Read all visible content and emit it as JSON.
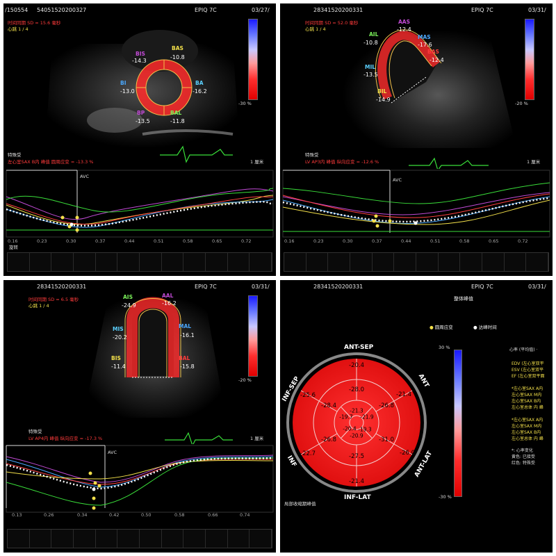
{
  "panels": [
    {
      "header": {
        "left": "/150554",
        "id": "54051520200327",
        "device": "EPIQ 7C",
        "date": "03/27/"
      },
      "info": {
        "line1": "时间同期 SD = 15.6 毫秒",
        "line2": "心跳 1 / 4"
      },
      "labels": [
        {
          "name": "BIS",
          "value": "-14.3",
          "color": "#c24bd6"
        },
        {
          "name": "BAS",
          "value": "-10.8",
          "color": "#f3e04a"
        },
        {
          "name": "BI",
          "value": "-13.0",
          "color": "#4aa8ff"
        },
        {
          "name": "BA",
          "value": "-16.2",
          "color": "#5ad0ff"
        },
        {
          "name": "BP",
          "value": "-13.5",
          "color": "#c24bd6"
        },
        {
          "name": "BAL",
          "value": "-11.8",
          "color": "#7bf05a"
        }
      ],
      "scale_label": "-30 %",
      "cm_label": "1 厘米",
      "footer_line1": "特殊受",
      "footer_line2": "左心室SAX B内 峰值 圆周应变 = -13.3 %",
      "avc": "AVC",
      "x_ticks": [
        "0.16",
        "0.23",
        "0.30",
        "0.37",
        "0.44",
        "0.51",
        "0.58",
        "0.65",
        "0.72"
      ],
      "graph_title": "旋转"
    },
    {
      "header": {
        "left": "",
        "id": "28341520200331",
        "device": "EPIQ 7C",
        "date": "03/31/"
      },
      "info": {
        "line1": "时间同期 SD = 52.0 毫秒",
        "line2": "心跳 1 / 4"
      },
      "labels": [
        {
          "name": "AAS",
          "value": "-12.4",
          "color": "#c24bd6"
        },
        {
          "name": "AIL",
          "value": "-10.8",
          "color": "#7bf05a"
        },
        {
          "name": "MAS",
          "value": "-17.6",
          "color": "#4aa8ff"
        },
        {
          "name": "BAS",
          "value": "-12.4",
          "color": "#ff3b3b"
        },
        {
          "name": "MIL",
          "value": "-13.5",
          "color": "#5ad0ff"
        },
        {
          "name": "BIL",
          "value": "-14.9",
          "color": "#f3e04a"
        }
      ],
      "scale_label": "-20 %",
      "cm_label": "1 厘米",
      "footer_line1": "特殊受",
      "footer_line2": "LV AP3内 峰值 纵向应变 = -12.6 %",
      "avc": "AVC",
      "x_ticks": [
        "0.16",
        "0.23",
        "0.30",
        "0.37",
        "0.44",
        "0.51",
        "0.58",
        "0.65",
        "0.72"
      ],
      "graph_title": ""
    },
    {
      "header": {
        "left": "",
        "id": "28341520200331",
        "device": "EPIQ 7C",
        "date": "03/31/"
      },
      "info": {
        "line1": "时间同期 SD = 6.5 毫秒",
        "line2": "心跳 1 / 4"
      },
      "labels": [
        {
          "name": "AIS",
          "value": "-24.9",
          "color": "#7bf05a"
        },
        {
          "name": "AAL",
          "value": "-16.2",
          "color": "#c24bd6"
        },
        {
          "name": "MIS",
          "value": "-20.2",
          "color": "#5ad0ff"
        },
        {
          "name": "MAL",
          "value": "-16.1",
          "color": "#4aa8ff"
        },
        {
          "name": "BIS",
          "value": "-11.4",
          "color": "#f3e04a"
        },
        {
          "name": "BAL",
          "value": "-15.8",
          "color": "#ff3b3b"
        }
      ],
      "scale_label": "-20 %",
      "cm_label": "1 厘米",
      "footer_line1": "特殊受",
      "footer_line2": "LV AP4内 峰值 纵向应变 = -17.3 %",
      "avc": "AVC",
      "x_ticks": [
        "0.13",
        "0.26",
        "0.34",
        "0.42",
        "0.50",
        "0.58",
        "0.66",
        "0.74"
      ],
      "graph_title": ""
    }
  ],
  "bullseye": {
    "header": {
      "id": "28341520200331",
      "device": "EPIQ 7C",
      "date": "03/31/"
    },
    "title": "整体峰值",
    "legend1": "圆周应变",
    "legend2": "达峰时间",
    "wall_labels": {
      "top": "ANT-SEP",
      "tr": "ANT",
      "br": "ANT-LAT",
      "bottom": "INF-LAT",
      "bl": "INF",
      "tl": "INF-SEP"
    },
    "segments": {
      "basal": [
        "-20.4",
        "-21.4",
        "-26.0",
        "-21.4",
        "-22.7",
        "-25.6"
      ],
      "mid": [
        "-28.0",
        "-26.8",
        "-31.0",
        "-27.5",
        "-26.8",
        "-28.4"
      ],
      "apical": [
        "-21.3",
        "-21.9",
        "-19.3",
        "-20.4",
        "-19.7"
      ],
      "apex": "-20.9"
    },
    "scale_top": "30 %",
    "scale_bottom": "-30 %",
    "footer": "局部收缩期峰值",
    "side_lines": [
      {
        "text": "心率 (平均值) ·",
        "color": "#ddd"
      },
      {
        "text": "EDV (左心室双平",
        "color": "#f3e04a"
      },
      {
        "text": "ESV (左心室双平",
        "color": "#f3e04a"
      },
      {
        "text": "EF (左心室双平面",
        "color": "#f3e04a"
      },
      {
        "text": "*左心室SAX A内",
        "color": "#f3e04a"
      },
      {
        "text": "左心室SAX M内",
        "color": "#f3e04a"
      },
      {
        "text": "左心室SAX B内",
        "color": "#f3e04a"
      },
      {
        "text": "左心室总体 内 峰",
        "color": "#f3e04a"
      },
      {
        "text": "*左心室SAX A内",
        "color": "#f3e04a"
      },
      {
        "text": "左心室SAX M内",
        "color": "#f3e04a"
      },
      {
        "text": "左心室SAX B内",
        "color": "#f3e04a"
      },
      {
        "text": "左心室总体 内 峰",
        "color": "#f3e04a"
      },
      {
        "text": "*:      心率变化",
        "color": "#ddd"
      },
      {
        "text": "黄色: 已接受",
        "color": "#ddd"
      },
      {
        "text": "红色: 特殊受",
        "color": "#ddd"
      }
    ]
  }
}
